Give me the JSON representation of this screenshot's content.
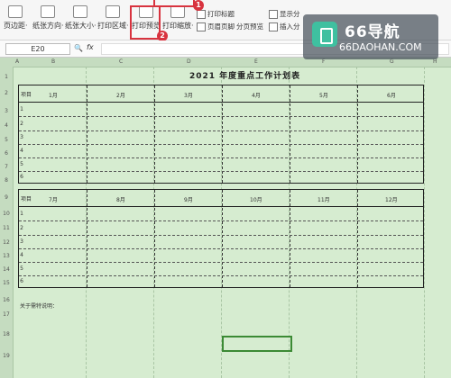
{
  "ribbon": {
    "buttons": [
      {
        "label": "页边距·",
        "icon": "margins-icon"
      },
      {
        "label": "纸张方向·",
        "icon": "orientation-icon"
      },
      {
        "label": "纸张大小·",
        "icon": "paper-size-icon"
      },
      {
        "label": "打印区域·",
        "icon": "print-area-icon"
      },
      {
        "label": "打印预览",
        "icon": "print-preview-icon"
      },
      {
        "label": "打印缩放·",
        "icon": "print-scale-icon"
      }
    ],
    "small": {
      "print_titles": "打印标题",
      "header_footer": "页眉页脚",
      "page_break": "分页预览",
      "show_split": "显示分",
      "insert": "插入分"
    },
    "markers": [
      "1",
      "2"
    ]
  },
  "formula": {
    "cell_ref": "E20",
    "fx": "fx"
  },
  "sheet": {
    "columns": [
      "A",
      "B",
      "C",
      "D",
      "E",
      "F",
      "G",
      "H"
    ],
    "rows": [
      "1",
      "2",
      "3",
      "4",
      "5",
      "6",
      "7",
      "8",
      "9",
      "10",
      "11",
      "12",
      "13",
      "14",
      "15",
      "16",
      "17",
      "18",
      "19"
    ],
    "title": "2021 年度重点工作计划表",
    "table1": {
      "header_label": "项目",
      "months": [
        "1月",
        "2月",
        "3月",
        "4月",
        "5月",
        "6月"
      ],
      "items": [
        "1",
        "2",
        "3",
        "4",
        "5",
        "6"
      ]
    },
    "table2": {
      "header_label": "项目",
      "months": [
        "7月",
        "8月",
        "9月",
        "10月",
        "11月",
        "12月"
      ],
      "items": [
        "1",
        "2",
        "3",
        "4",
        "5",
        "6"
      ]
    },
    "note": "关于需特说明："
  },
  "watermark": {
    "name": "66导航",
    "domain": "66DAOHAN.COM"
  }
}
